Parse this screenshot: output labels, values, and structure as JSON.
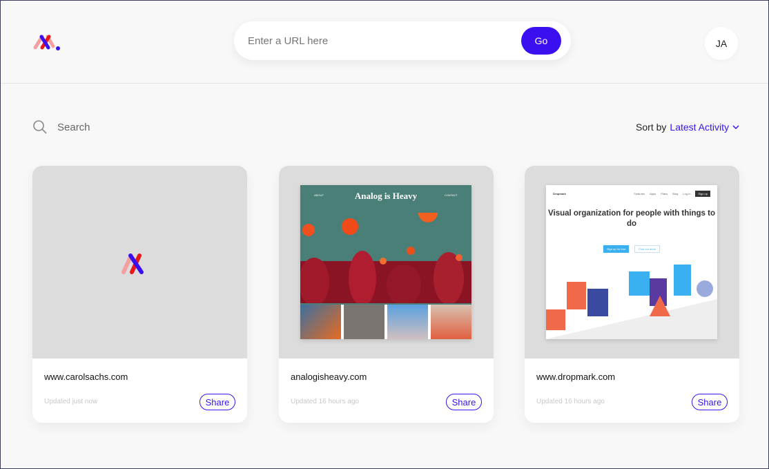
{
  "header": {
    "url_placeholder": "Enter a URL here",
    "go_label": "Go",
    "avatar_initials": "JA"
  },
  "toolbar": {
    "search_label": "Search",
    "sort_prefix": "Sort by",
    "sort_value": "Latest Activity"
  },
  "cards": [
    {
      "domain": "www.carolsachs.com",
      "updated": "Updated just now",
      "share": "Share"
    },
    {
      "domain": "analogisheavy.com",
      "updated": "Updated 16 hours ago",
      "share": "Share",
      "thumb": {
        "title": "Analog is Heavy",
        "nav_left": "ABOUT",
        "nav_right": "CONTACT"
      }
    },
    {
      "domain": "www.dropmark.com",
      "updated": "Updated 16 hours ago",
      "share": "Share",
      "thumb": {
        "brand": "Dropmark",
        "nav": [
          "Features",
          "Apps",
          "Plans",
          "Blog",
          "Log In"
        ],
        "signup": "Sign up",
        "headline": "Visual organization for people with things to do",
        "cta1": "Sign up for free",
        "cta2": "Find out more"
      }
    }
  ],
  "colors": {
    "accent": "#3a10f0",
    "background": "#f8f8f8"
  }
}
